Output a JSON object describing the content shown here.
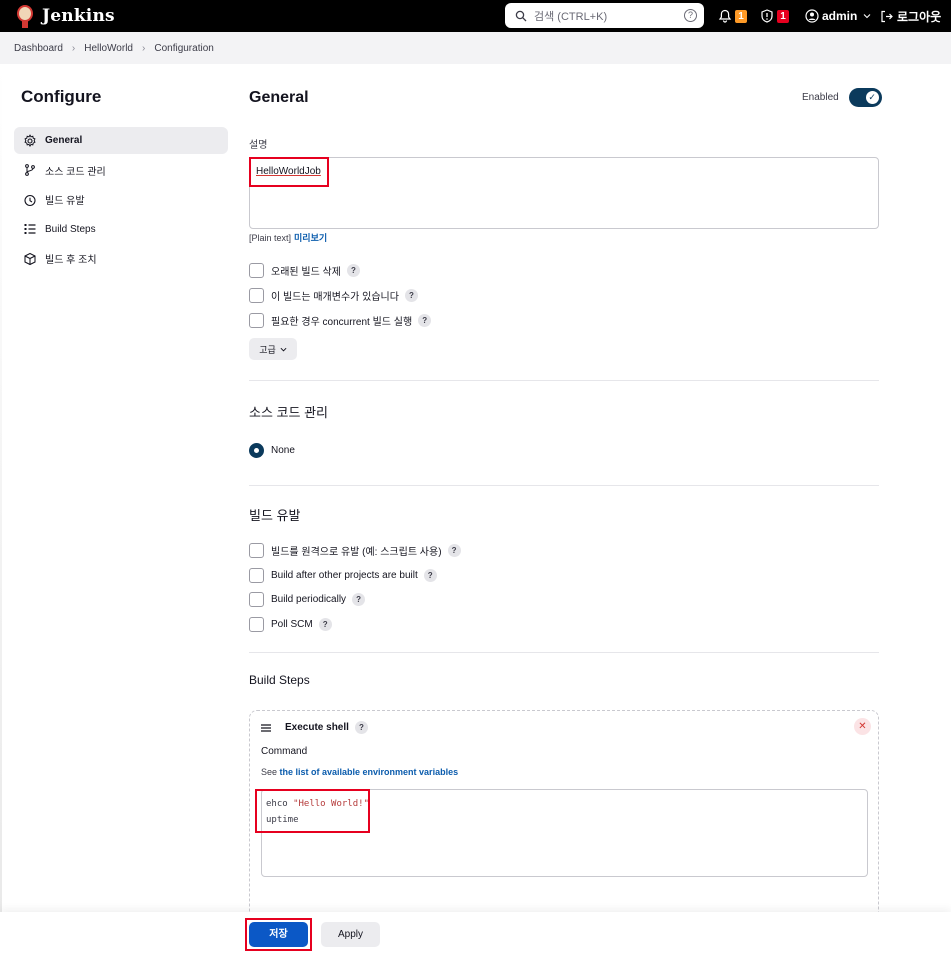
{
  "header": {
    "app_name": "Jenkins",
    "search_placeholder": "검색 (CTRL+K)",
    "notifications_count": "1",
    "security_count": "1",
    "user": "admin",
    "logout": "로그아웃"
  },
  "breadcrumb": [
    "Dashboard",
    "HelloWorld",
    "Configuration"
  ],
  "sidebar": {
    "title": "Configure",
    "items": [
      {
        "label": "General",
        "icon": "gear-icon"
      },
      {
        "label": "소스 코드 관리",
        "icon": "branch-icon"
      },
      {
        "label": "빌드 유발",
        "icon": "clock-icon"
      },
      {
        "label": "Build Steps",
        "icon": "list-icon"
      },
      {
        "label": "빌드 후 조치",
        "icon": "cube-icon"
      }
    ]
  },
  "general": {
    "title": "General",
    "enabled_label": "Enabled",
    "description_label": "설명",
    "description_value": "HelloWorldJob",
    "plain_text": "[Plain text]",
    "preview_link": "미리보기",
    "options": [
      "오래된 빌드 삭제",
      "이 빌드는 매개변수가 있습니다",
      "필요한 경우 concurrent 빌드 실행"
    ],
    "advanced_button": "고급"
  },
  "scm": {
    "title": "소스 코드 관리",
    "selected": "None"
  },
  "triggers": {
    "title": "빌드 유발",
    "options": [
      "빌드를 원격으로 유발 (예: 스크립트 사용)",
      "Build after other projects are built",
      "Build periodically",
      "Poll SCM"
    ]
  },
  "build_steps": {
    "title": "Build Steps",
    "step_name": "Execute shell",
    "command_label": "Command",
    "see_prefix": "See ",
    "env_link": "the list of available environment variables",
    "command_line1_cmd": "ehco ",
    "command_line1_str": "\"Hello World!\"",
    "command_line2": "uptime"
  },
  "actions": {
    "save": "저장",
    "apply": "Apply"
  },
  "colors": {
    "accent": "#0b58c6",
    "toggle": "#0b3a5c",
    "highlight": "#e6001f"
  }
}
